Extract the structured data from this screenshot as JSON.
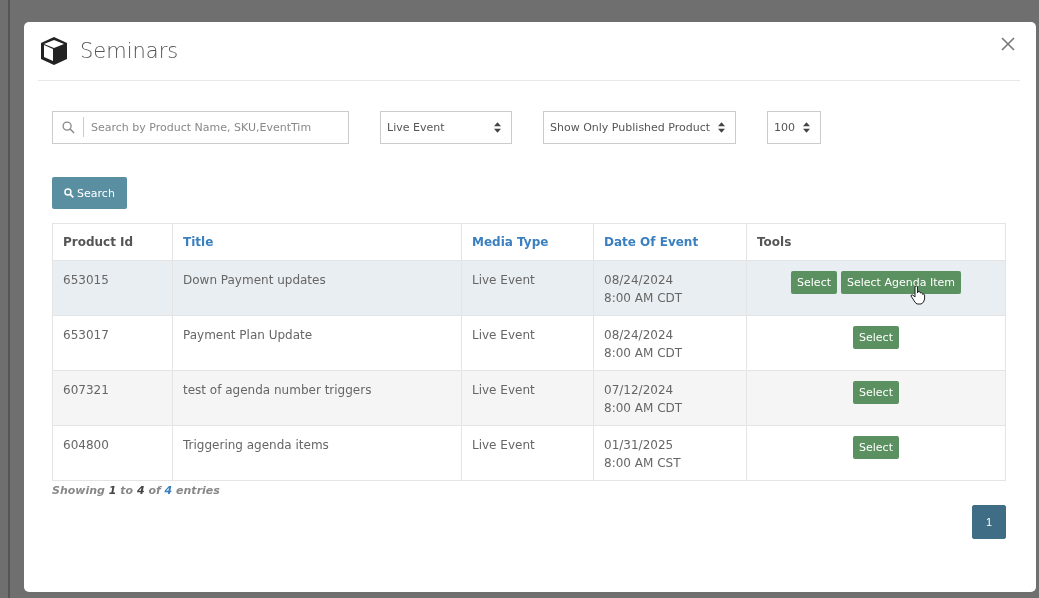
{
  "dialog": {
    "title": "Seminars"
  },
  "filters": {
    "search": {
      "placeholder": "Search by Product Name, SKU,EventTim"
    },
    "selects": [
      {
        "value": "Live Event",
        "kind": "wide"
      },
      {
        "value": "Show Only Published Product",
        "kind": "auto"
      },
      {
        "value": "100",
        "kind": "auto"
      }
    ],
    "search_button": "Search"
  },
  "table": {
    "columns": [
      {
        "label": "Product Id",
        "sortable": false
      },
      {
        "label": "Title",
        "sortable": true
      },
      {
        "label": "Media Type",
        "sortable": true
      },
      {
        "label": "Date Of Event",
        "sortable": true
      },
      {
        "label": "Tools",
        "sortable": false
      }
    ],
    "rows": [
      {
        "selected": true,
        "cells": [
          "653015",
          "Down Payment updates",
          "Live Event"
        ],
        "date": "08/24/2024",
        "time": "8:00 AM CDT",
        "tools": [
          "Select",
          "Select Agenda Item"
        ],
        "cursor": true
      },
      {
        "selected": false,
        "cells": [
          "653017",
          "Payment Plan Update",
          "Live Event"
        ],
        "date": "08/24/2024",
        "time": "8:00 AM CDT",
        "tools": [
          "Select"
        ],
        "cursor": false
      },
      {
        "selected": false,
        "cells": [
          "607321",
          "test of agenda number triggers",
          "Live Event"
        ],
        "date": "07/12/2024",
        "time": "8:00 AM CDT",
        "tools": [
          "Select"
        ],
        "cursor": false
      },
      {
        "selected": false,
        "cells": [
          "604800",
          "Triggering agenda items",
          "Live Event"
        ],
        "date": "01/31/2025",
        "time": "8:00 AM CST",
        "tools": [
          "Select"
        ],
        "cursor": false
      }
    ]
  },
  "info": [
    {
      "text": "Showing",
      "kind": "plain"
    },
    {
      "text": "1",
      "kind": "bold"
    },
    {
      "text": "to",
      "kind": "plain"
    },
    {
      "text": "4",
      "kind": "bold"
    },
    {
      "text": "of",
      "kind": "plain"
    },
    {
      "text": "4",
      "kind": "link"
    },
    {
      "text": "entries",
      "kind": "plain"
    }
  ],
  "pagination": [
    {
      "label": "1",
      "selected": true
    }
  ]
}
